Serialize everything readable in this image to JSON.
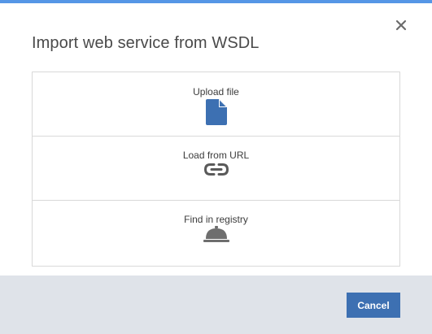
{
  "dialog": {
    "title": "Import web service from WSDL",
    "close_icon": "close-icon",
    "accent_color": "#5596e6"
  },
  "options": [
    {
      "label": "Upload file",
      "icon": "file-icon",
      "icon_color": "#3d70b2"
    },
    {
      "label": "Load from URL",
      "icon": "link-icon",
      "icon_color": "#5a5a5a"
    },
    {
      "label": "Find in registry",
      "icon": "service-bell-icon",
      "icon_color": "#6e6e6e"
    }
  ],
  "footer": {
    "cancel_label": "Cancel",
    "button_color": "#3d70b2",
    "background": "#dfe3e9"
  }
}
